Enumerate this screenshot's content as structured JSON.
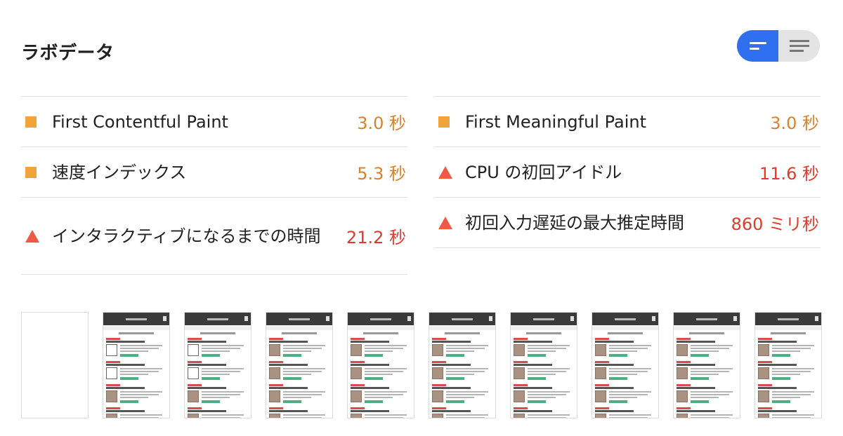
{
  "section": {
    "title": "ラボデータ"
  },
  "toggle": {
    "active_icon": "view-bars-icon",
    "inactive_icon": "view-list-icon"
  },
  "metrics_left": [
    {
      "label": "First Contentful Paint",
      "value": "3.0 秒",
      "status": "average",
      "icon": "average-square-icon"
    },
    {
      "label": "速度インデックス",
      "value": "5.3 秒",
      "status": "average",
      "icon": "average-square-icon"
    },
    {
      "label": "インタラクティブになるまでの時間",
      "value": "21.2 秒",
      "status": "fail",
      "icon": "fail-triangle-icon"
    }
  ],
  "metrics_right": [
    {
      "label": "First Meaningful Paint",
      "value": "3.0 秒",
      "status": "average",
      "icon": "average-square-icon"
    },
    {
      "label": "CPU の初回アイドル",
      "value": "11.6 秒",
      "status": "fail",
      "icon": "fail-triangle-icon"
    },
    {
      "label": "初回入力遅延の最大推定時間",
      "value": "860 ミリ秒",
      "status": "fail",
      "icon": "fail-triangle-icon"
    }
  ],
  "colors": {
    "average": "#f2a33a",
    "fail": "#ee5a44",
    "toggle_active": "#2f6ff0"
  },
  "filmstrip": {
    "frame_count": 10,
    "blank_frames": [
      0
    ],
    "frames_without_images": [
      1,
      2
    ]
  }
}
